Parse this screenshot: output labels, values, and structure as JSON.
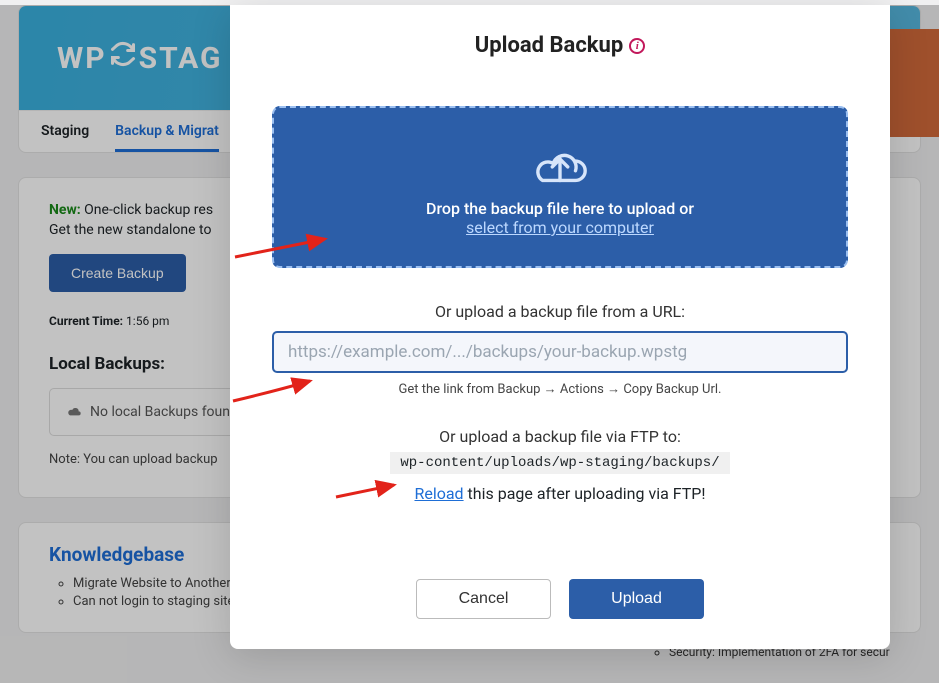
{
  "logo": {
    "pre": "WP",
    "post": "STAG"
  },
  "tabs": {
    "staging": "Staging",
    "backup": "Backup & Migrat"
  },
  "bg": {
    "new_label": "New:",
    "new_text": "One-click backup res",
    "desc2": "Get the new standalone to",
    "create_btn": "Create Backup",
    "time_label": "Current Time:",
    "time_value": "1:56 pm",
    "local_heading": "Local Backups:",
    "no_local": "No local Backups found",
    "note": "Note: You can upload backup"
  },
  "kb": {
    "heading": "Knowledgebase",
    "items": [
      "Migrate Website to Another",
      "Can not login to staging site"
    ]
  },
  "right_item": "Security: Implementation of 2FA for secur",
  "modal": {
    "title": "Upload Backup",
    "drop_text": "Drop the backup file here to upload or",
    "drop_link": "select from your computer",
    "or_url": "Or upload a backup file from a URL:",
    "url_placeholder": "https://example.com/.../backups/your-backup.wpstg",
    "url_hint": "Get the link from Backup → Actions → Copy Backup Url.",
    "or_ftp": "Or upload a backup file via FTP to:",
    "ftp_path": "wp-content/uploads/wp-staging/backups/",
    "reload_link": "Reload",
    "reload_rest": " this page after uploading via FTP!",
    "cancel": "Cancel",
    "upload": "Upload"
  }
}
